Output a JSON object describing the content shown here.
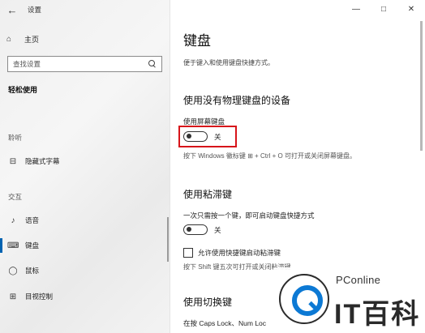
{
  "window": {
    "app_title": "设置",
    "controls": {
      "minimize": "—",
      "maximize": "□",
      "close": "✕"
    }
  },
  "sidebar": {
    "back_glyph": "←",
    "home": {
      "icon_glyph": "⌂",
      "label": "主页"
    },
    "search": {
      "placeholder": "查找设置"
    },
    "section_title": "轻松使用",
    "groups": [
      {
        "title": "聆听",
        "items": [
          {
            "icon": "captions-icon",
            "glyph": "⊟",
            "label": "隐藏式字幕",
            "active": false
          }
        ]
      },
      {
        "title": "交互",
        "items": [
          {
            "icon": "microphone-icon",
            "glyph": "♪",
            "label": "语音",
            "active": false
          },
          {
            "icon": "keyboard-icon",
            "glyph": "⌨",
            "label": "键盘",
            "active": true
          },
          {
            "icon": "mouse-icon",
            "glyph": "◯",
            "label": "鼠标",
            "active": false
          },
          {
            "icon": "eye-control-icon",
            "glyph": "⊞",
            "label": "目视控制",
            "active": false
          }
        ]
      }
    ]
  },
  "main": {
    "title": "键盘",
    "description": "便于键入和使用键盘快捷方式。",
    "onscreen": {
      "heading": "使用没有物理键盘的设备",
      "label": "使用屏幕键盘",
      "toggle_state": "关",
      "hint": "按下 Windows 徽标键 ⊞ + Ctrl + O 可打开或关闭屏幕键盘。"
    },
    "sticky": {
      "heading": "使用粘滞键",
      "label": "一次只需按一个键，即可启动键盘快捷方式",
      "toggle_state": "关",
      "checkbox_label": "允许使用快捷键启动粘滞键",
      "hint": "按下 Shift 键五次可打开或关闭粘滞键"
    },
    "toggle_keys": {
      "heading": "使用切换键",
      "label": "在按 Caps Lock、Num Loc"
    }
  },
  "watermark": {
    "small": "PConline",
    "big": "IT百科"
  }
}
